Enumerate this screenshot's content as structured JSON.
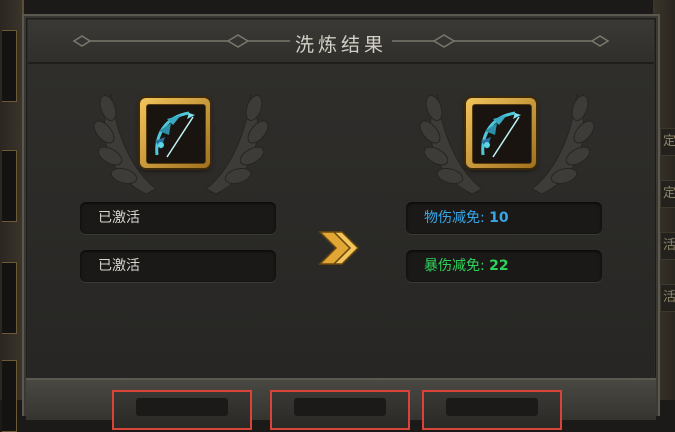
{
  "dialog": {
    "title": "洗炼结果"
  },
  "left": {
    "item_icon": "bow-weapon-icon",
    "attributes": [
      {
        "text": "已激活"
      },
      {
        "text": "已激活"
      }
    ]
  },
  "right": {
    "item_icon": "bow-weapon-icon",
    "attributes": [
      {
        "label": "物伤减免:",
        "value": "10",
        "color": "#35a7e8"
      },
      {
        "label": "暴伤减免:",
        "value": "22",
        "color": "#2fd35a"
      }
    ]
  },
  "transition_icon": "double-chevron-right-icon",
  "background_peeks": [
    "定",
    "定",
    "活",
    "活"
  ],
  "colors": {
    "accent_gold": "#e2a634",
    "button_border": "#d8433a"
  }
}
